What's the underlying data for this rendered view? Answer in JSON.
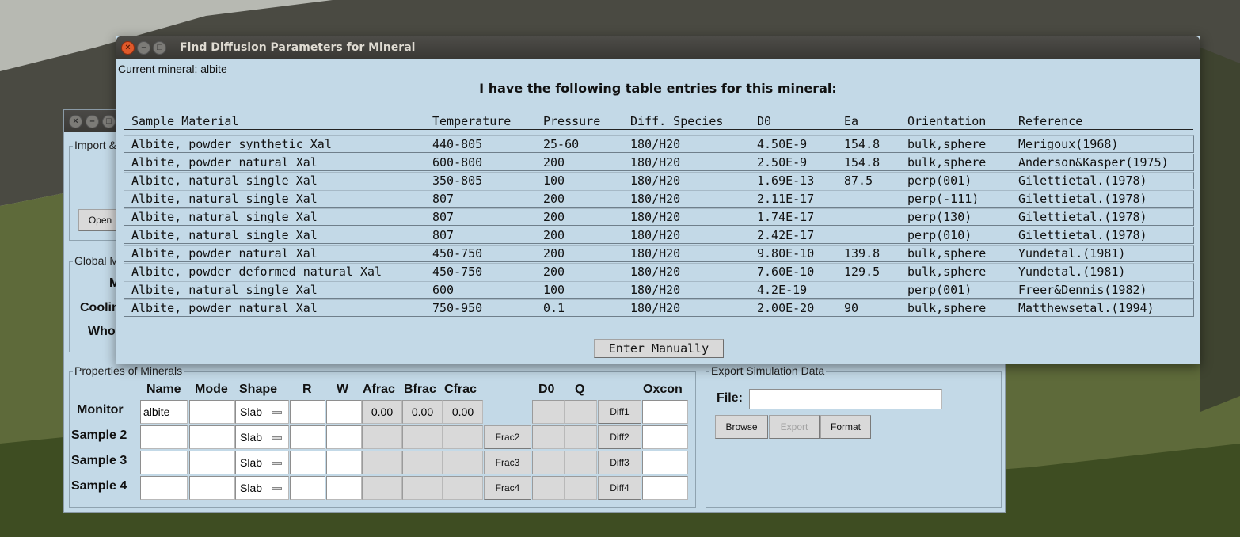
{
  "dialog": {
    "title": "Find Diffusion Parameters for Mineral",
    "current_mineral": "Current mineral: albite",
    "heading": "I have the following table entries for this mineral:",
    "columns": [
      "Sample Material",
      "Temperature",
      "Pressure",
      "Diff. Species",
      "D0",
      "Ea",
      "Orientation",
      "Reference"
    ],
    "rows": [
      [
        "Albite, powder synthetic Xal",
        "440-805",
        "25-60",
        "180/H20",
        "4.50E-9",
        "154.8",
        "bulk,sphere",
        "Merigoux(1968)"
      ],
      [
        "Albite, powder natural Xal",
        "600-800",
        "200",
        "180/H20",
        "2.50E-9",
        "154.8",
        "bulk,sphere",
        "Anderson&Kasper(1975)"
      ],
      [
        "Albite, natural single Xal",
        "350-805",
        "100",
        "180/H20",
        "1.69E-13",
        "87.5",
        "perp(001)",
        "Gilettietal.(1978)"
      ],
      [
        "Albite, natural single Xal",
        "807",
        "200",
        "180/H20",
        "2.11E-17",
        "",
        "perp(-111)",
        "Gilettietal.(1978)"
      ],
      [
        "Albite, natural single Xal",
        "807",
        "200",
        "180/H20",
        "1.74E-17",
        "",
        "perp(130)",
        "Gilettietal.(1978)"
      ],
      [
        "Albite, natural single Xal",
        "807",
        "200",
        "180/H20",
        "2.42E-17",
        "",
        "perp(010)",
        "Gilettietal.(1978)"
      ],
      [
        "Albite, powder natural Xal",
        "450-750",
        "200",
        "180/H20",
        "9.80E-10",
        "139.8",
        "bulk,sphere",
        "Yundetal.(1981)"
      ],
      [
        "Albite, powder deformed natural Xal",
        "450-750",
        "200",
        "180/H20",
        "7.60E-10",
        "129.5",
        "bulk,sphere",
        "Yundetal.(1981)"
      ],
      [
        "Albite, natural single Xal",
        "600",
        "100",
        "180/H20",
        "4.2E-19",
        "",
        "perp(001)",
        "Freer&Dennis(1982)"
      ],
      [
        "Albite, powder natural Xal",
        "750-950",
        "0.1",
        "180/H20",
        "2.00E-20",
        "90",
        "bulk,sphere",
        "Matthewsetal.(1994)"
      ]
    ],
    "separator": "-------------------------------------------------------------------------------------------",
    "enter_button": "Enter Manually"
  },
  "main": {
    "import_group": "Import &",
    "open_button": "Open",
    "global_group": "Global M",
    "global_labels": [
      "M",
      "Coolin",
      "Who"
    ],
    "properties_group": "Properties of Minerals",
    "headers": [
      "Name",
      "Mode",
      "Shape",
      "R",
      "W",
      "Afrac",
      "Bfrac",
      "Cfrac",
      "D0",
      "Q",
      "Oxcon"
    ],
    "rows": [
      {
        "label": "Monitor",
        "name": "albite",
        "shape": "Slab",
        "afrac": "0.00",
        "bfrac": "0.00",
        "cfrac": "0.00",
        "frac": "",
        "diff": "Diff1"
      },
      {
        "label": "Sample 2",
        "name": "",
        "shape": "Slab",
        "afrac": "",
        "bfrac": "",
        "cfrac": "",
        "frac": "Frac2",
        "diff": "Diff2"
      },
      {
        "label": "Sample 3",
        "name": "",
        "shape": "Slab",
        "afrac": "",
        "bfrac": "",
        "cfrac": "",
        "frac": "Frac3",
        "diff": "Diff3"
      },
      {
        "label": "Sample 4",
        "name": "",
        "shape": "Slab",
        "afrac": "",
        "bfrac": "",
        "cfrac": "",
        "frac": "Frac4",
        "diff": "Diff4"
      }
    ],
    "export_group": "Export Simulation Data",
    "file_label": "File:",
    "file_value": "",
    "browse_button": "Browse",
    "export_button": "Export",
    "format_button": "Format"
  },
  "colors": {
    "window_bg": "#c3d9e7",
    "titlebar": "#3b3a37",
    "close_button": "#e05a2b"
  }
}
